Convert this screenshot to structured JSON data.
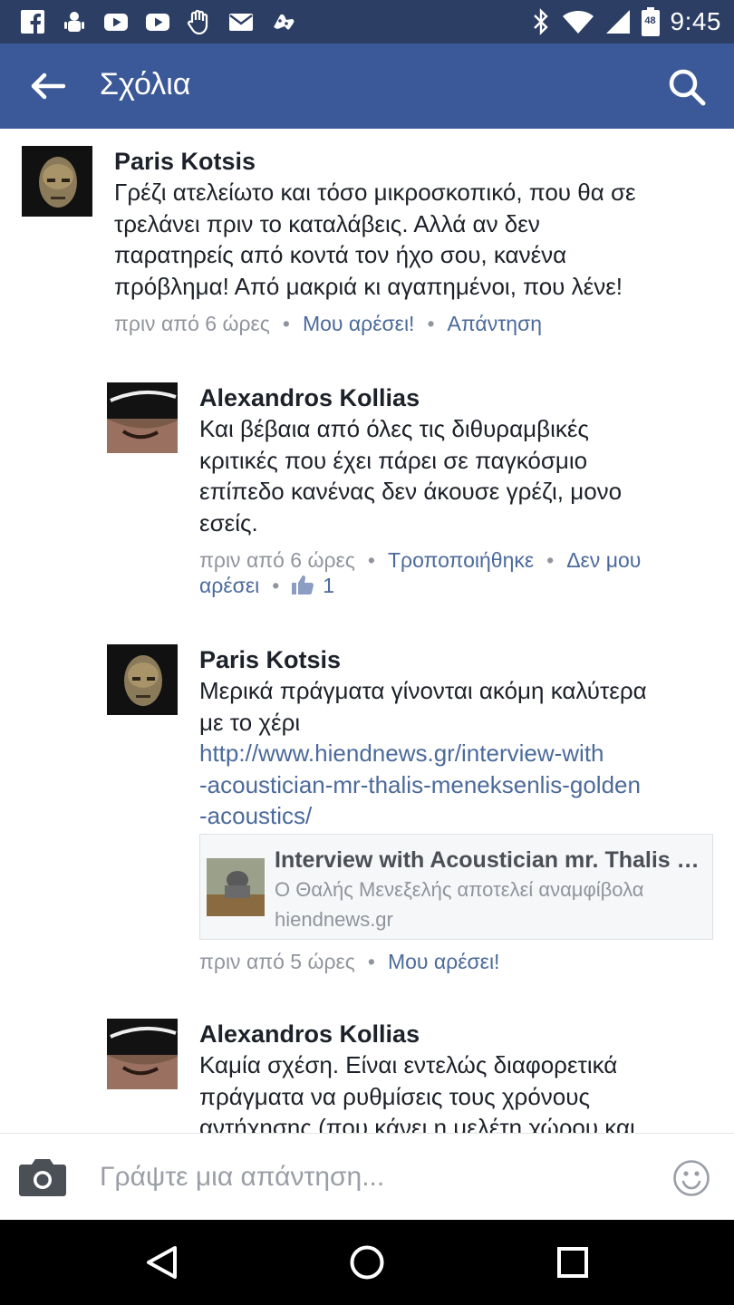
{
  "status_bar": {
    "time": "9:45",
    "battery_level": "48",
    "left_icons": [
      "facebook-icon",
      "android-debug-icon",
      "youtube-icon",
      "youtube-icon",
      "hand-icon",
      "mail-icon",
      "game-controller-icon"
    ],
    "right_icons": [
      "bluetooth-icon",
      "wifi-icon",
      "signal-icon",
      "battery-icon"
    ]
  },
  "header": {
    "title": "Σχόλια",
    "back_icon": "arrow-left-icon",
    "search_icon": "search-icon"
  },
  "comments": [
    {
      "author": "Paris Kotsis",
      "lines": [
        "Γρέζι ατελείωτο και τόσο μικροσκοπικό, που θα σε",
        "τρελάνει πριν το καταλάβεις. Αλλά αν δεν",
        "παρατηρείς από κοντά τον ήχο σου, κανένα",
        "πρόβλημα! Από μακριά κι αγαπημένοι, που λένε!"
      ],
      "time": "πριν από 6 ώρες",
      "like": "Μου αρέσει!",
      "reply": "Απάντηση"
    },
    {
      "author": "Alexandros Kollias",
      "lines": [
        "Και βέβαια από όλες τις διθυραμβικές",
        "κριτικές που έχει πάρει σε παγκόσμιο",
        "επίπεδο κανένας δεν άκουσε γρέζι, μονο",
        "εσείς."
      ],
      "time": "πριν από 6 ώρες",
      "edited": "Τροποποιήθηκε",
      "unlike_a": "Δεν μου",
      "unlike_b": "αρέσει",
      "like_count": "1"
    },
    {
      "author": "Paris Kotsis",
      "lines": [
        "Μερικά πράγματα γίνονται ακόμη καλύτερα",
        "με το χέρι"
      ],
      "link_lines": [
        "http://www.hiendnews.gr/interview-with",
        "-acoustician-mr-thalis-meneksenlis-golden",
        "-acoustics/"
      ],
      "preview": {
        "title": "Interview with Acoustician mr. Thalis Meneksenlis",
        "description": "Ο Θαλής Μενεξελής αποτελεί αναμφίβολα",
        "domain": "hiendnews.gr"
      },
      "time": "πριν από 5 ώρες",
      "like": "Μου αρέσει!"
    },
    {
      "author": "Alexandros Kollias",
      "lines": [
        "Καμία σχέση. Είναι εντελώς διαφορετικά",
        "πράγματα να ρυθμίσεις τους χρόνους",
        "αντήχησης (που κάνει η μελέτη χώρου και"
      ]
    }
  ],
  "composer": {
    "placeholder": "Γράψτε μια απάντηση...",
    "camera_icon": "camera-icon",
    "emoji_icon": "smiley-icon"
  },
  "nav": {
    "back_icon": "triangle-back-icon",
    "home_icon": "circle-home-icon",
    "recents_icon": "square-recents-icon"
  }
}
